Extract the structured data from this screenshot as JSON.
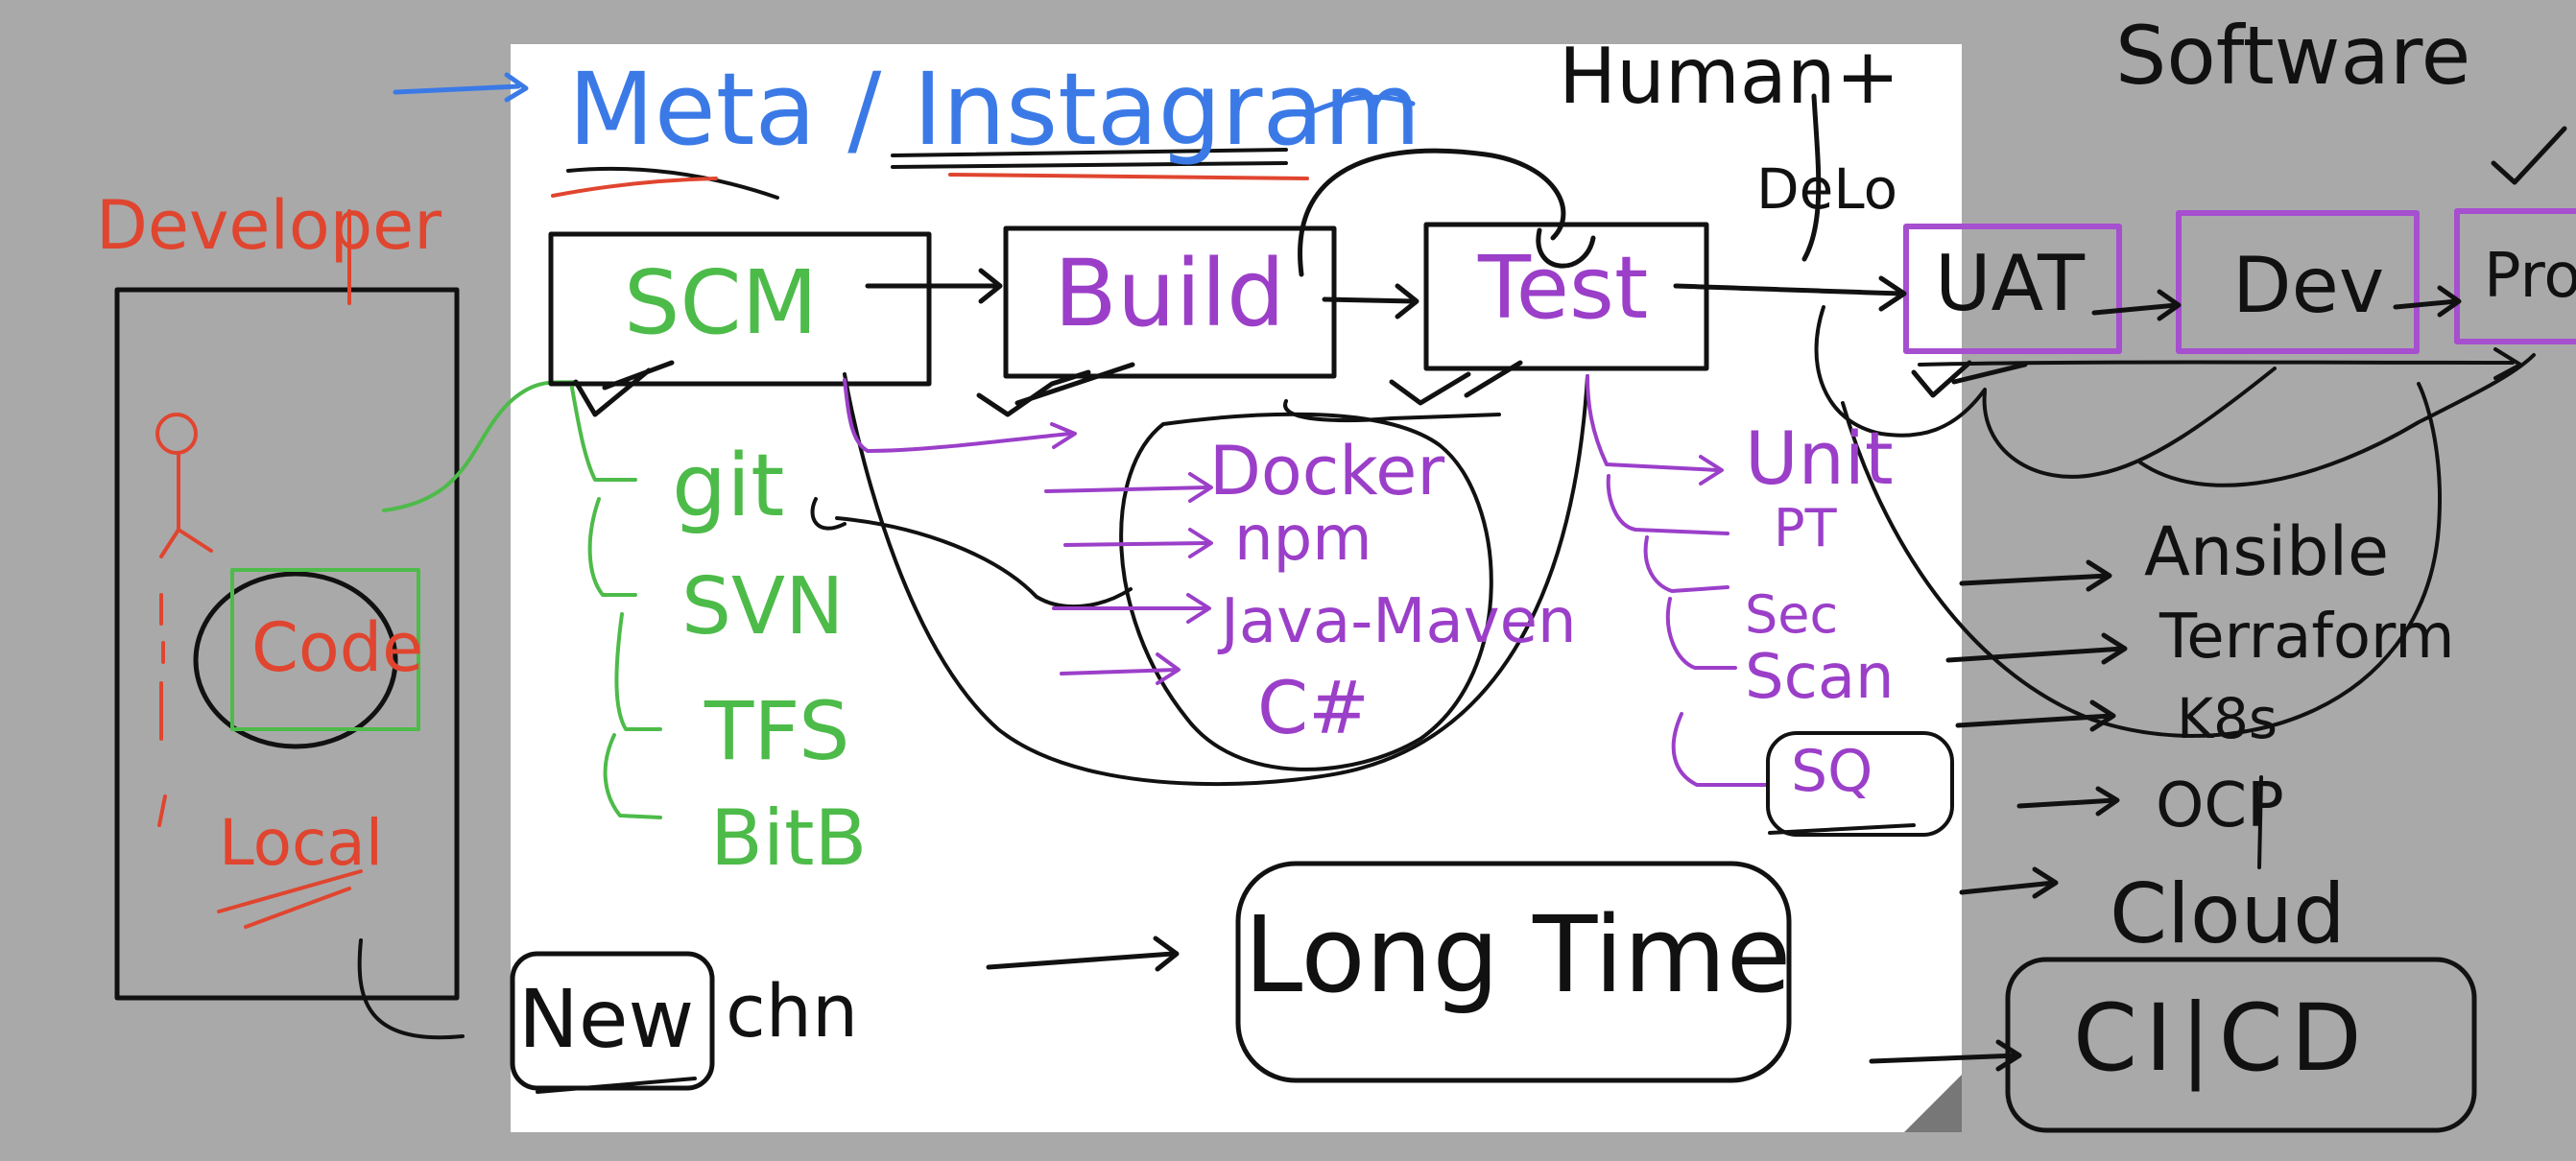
{
  "colors": {
    "background": "#a9a9a9",
    "paper": "#ffffff",
    "ink_black": "#111111",
    "ink_blue": "#3b7ae6",
    "ink_red": "#e0452f",
    "ink_purple": "#9b3fc9",
    "ink_green": "#4dbb49"
  },
  "header": {
    "company": "Meta / Instagram",
    "humans": "Human+",
    "software": "Software",
    "devops": "DeLo"
  },
  "developer": {
    "title": "Developer",
    "code": "Code",
    "local": "Local"
  },
  "pipeline": {
    "scm": "SCM",
    "build": "Build",
    "test": "Test",
    "uat": "UAT",
    "dev": "Dev",
    "prod": "Prod"
  },
  "scm_tools": [
    "git",
    "SVN",
    "TFS",
    "BitB"
  ],
  "build_tools": [
    "Docker",
    "npm",
    "Java-Maven",
    "C#"
  ],
  "test_tools": [
    "Unit",
    "PT",
    "Sec",
    "Scan",
    "SQ"
  ],
  "deploy_tools": [
    "Ansible",
    "Terraform",
    "K8s",
    "OCP",
    "Cloud"
  ],
  "bottom": {
    "new_change": "New",
    "change_suffix": "chn",
    "long_time": "Long Time",
    "cicd": "CI|CD"
  }
}
